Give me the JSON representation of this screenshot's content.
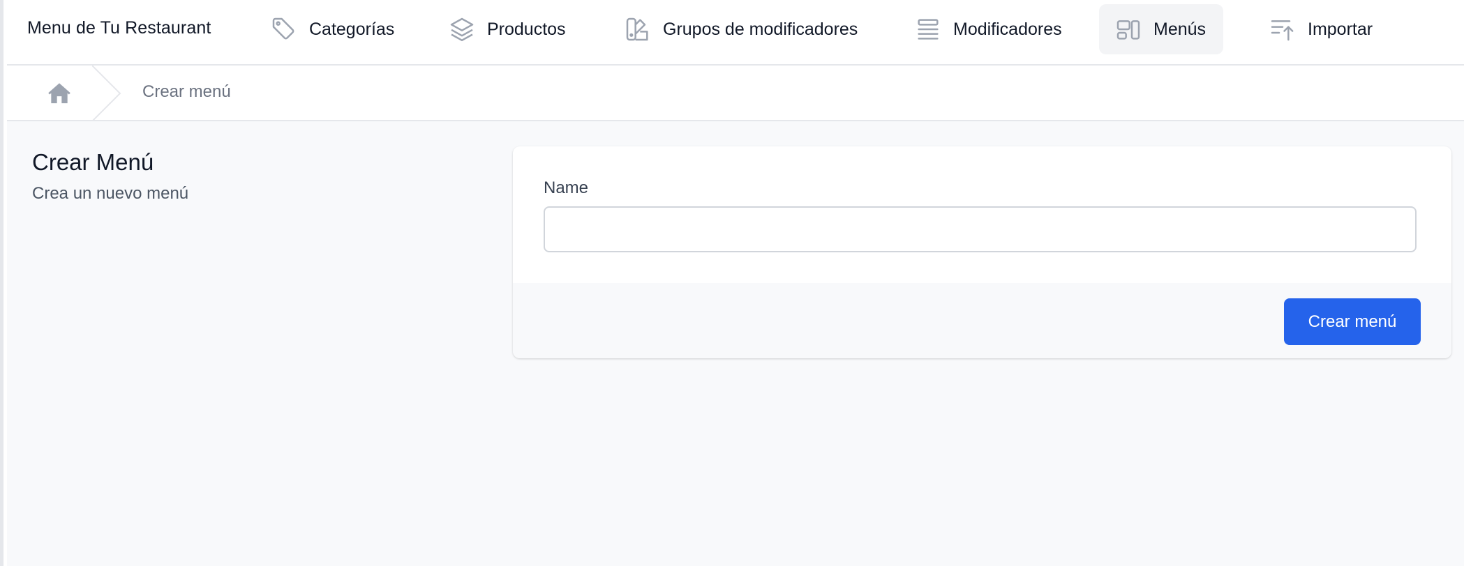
{
  "app": {
    "brand": "Menu de Tu Restaurant"
  },
  "nav": {
    "items": [
      {
        "label": "Categorías",
        "icon": "tag-icon"
      },
      {
        "label": "Productos",
        "icon": "layers-icon"
      },
      {
        "label": "Grupos de modificadores",
        "icon": "swatch-icon"
      },
      {
        "label": "Modificadores",
        "icon": "list-icon"
      },
      {
        "label": "Menús",
        "icon": "layout-icon",
        "active": true
      },
      {
        "label": "Importar",
        "icon": "import-sort-icon"
      }
    ]
  },
  "breadcrumb": {
    "home_icon": "home-icon",
    "current": "Crear menú"
  },
  "page": {
    "title": "Crear Menú",
    "subtitle": "Crea un nuevo menú"
  },
  "form": {
    "name_label": "Name",
    "name_value": "",
    "submit_label": "Crear menú"
  },
  "colors": {
    "accent": "#2563eb",
    "nav_active_bg": "#f3f4f6",
    "page_bg": "#f8f9fb",
    "icon_gray": "#9ca3af"
  }
}
